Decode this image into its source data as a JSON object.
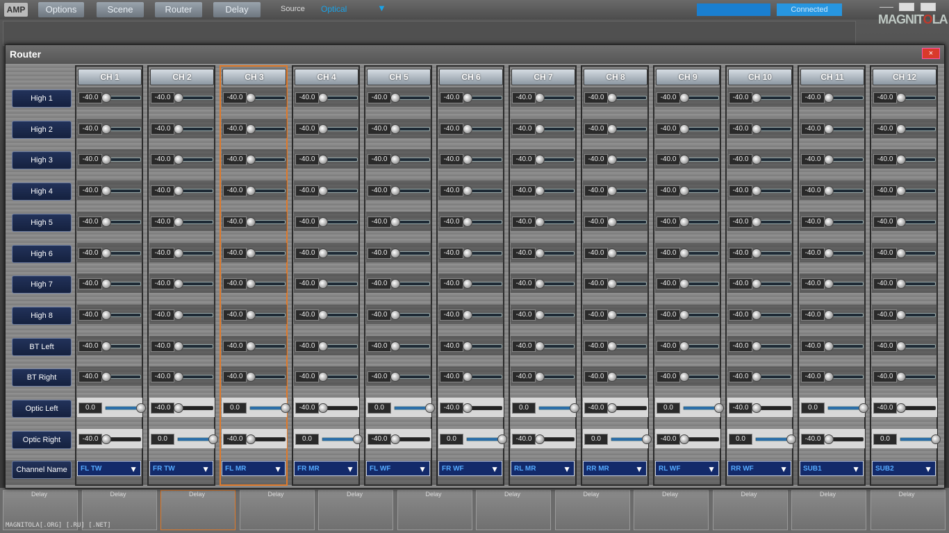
{
  "app": {
    "logo": "AMP",
    "menu": [
      "Options",
      "Scene",
      "Router",
      "Delay"
    ],
    "source_label": "Source",
    "source_value": "Optical",
    "status": "Connected",
    "brand": [
      "MAGNIT",
      "O",
      "LA"
    ],
    "footer": "MAGNITOLA[.ORG] [.RU] [.NET]",
    "delay_label": "Delay"
  },
  "router": {
    "title": "Router",
    "close": "×",
    "rows": [
      "High 1",
      "High 2",
      "High 3",
      "High 4",
      "High 5",
      "High 6",
      "High 7",
      "High 8",
      "BT Left",
      "BT Right",
      "Optic Left",
      "Optic Right"
    ],
    "channel_name_label": "Channel Name",
    "selected_channel": 2,
    "channels": [
      {
        "label": "CH 1",
        "name": "FL TW",
        "values": [
          "-40.0",
          "-40.0",
          "-40.0",
          "-40.0",
          "-40.0",
          "-40.0",
          "-40.0",
          "-40.0",
          "-40.0",
          "-40.0",
          "0.0",
          "-40.0"
        ]
      },
      {
        "label": "CH 2",
        "name": "FR TW",
        "values": [
          "-40.0",
          "-40.0",
          "-40.0",
          "-40.0",
          "-40.0",
          "-40.0",
          "-40.0",
          "-40.0",
          "-40.0",
          "-40.0",
          "-40.0",
          "0.0"
        ]
      },
      {
        "label": "CH 3",
        "name": "FL MR",
        "values": [
          "-40.0",
          "-40.0",
          "-40.0",
          "-40.0",
          "-40.0",
          "-40.0",
          "-40.0",
          "-40.0",
          "-40.0",
          "-40.0",
          "0.0",
          "-40.0"
        ]
      },
      {
        "label": "CH 4",
        "name": "FR MR",
        "values": [
          "-40.0",
          "-40.0",
          "-40.0",
          "-40.0",
          "-40.0",
          "-40.0",
          "-40.0",
          "-40.0",
          "-40.0",
          "-40.0",
          "-40.0",
          "0.0"
        ]
      },
      {
        "label": "CH 5",
        "name": "FL WF",
        "values": [
          "-40.0",
          "-40.0",
          "-40.0",
          "-40.0",
          "-40.0",
          "-40.0",
          "-40.0",
          "-40.0",
          "-40.0",
          "-40.0",
          "0.0",
          "-40.0"
        ]
      },
      {
        "label": "CH 6",
        "name": "FR WF",
        "values": [
          "-40.0",
          "-40.0",
          "-40.0",
          "-40.0",
          "-40.0",
          "-40.0",
          "-40.0",
          "-40.0",
          "-40.0",
          "-40.0",
          "-40.0",
          "0.0"
        ]
      },
      {
        "label": "CH 7",
        "name": "RL MR",
        "values": [
          "-40.0",
          "-40.0",
          "-40.0",
          "-40.0",
          "-40.0",
          "-40.0",
          "-40.0",
          "-40.0",
          "-40.0",
          "-40.0",
          "0.0",
          "-40.0"
        ]
      },
      {
        "label": "CH 8",
        "name": "RR MR",
        "values": [
          "-40.0",
          "-40.0",
          "-40.0",
          "-40.0",
          "-40.0",
          "-40.0",
          "-40.0",
          "-40.0",
          "-40.0",
          "-40.0",
          "-40.0",
          "0.0"
        ]
      },
      {
        "label": "CH 9",
        "name": "RL WF",
        "values": [
          "-40.0",
          "-40.0",
          "-40.0",
          "-40.0",
          "-40.0",
          "-40.0",
          "-40.0",
          "-40.0",
          "-40.0",
          "-40.0",
          "0.0",
          "-40.0"
        ]
      },
      {
        "label": "CH 10",
        "name": "RR WF",
        "values": [
          "-40.0",
          "-40.0",
          "-40.0",
          "-40.0",
          "-40.0",
          "-40.0",
          "-40.0",
          "-40.0",
          "-40.0",
          "-40.0",
          "-40.0",
          "0.0"
        ]
      },
      {
        "label": "CH 11",
        "name": "SUB1",
        "values": [
          "-40.0",
          "-40.0",
          "-40.0",
          "-40.0",
          "-40.0",
          "-40.0",
          "-40.0",
          "-40.0",
          "-40.0",
          "-40.0",
          "0.0",
          "-40.0"
        ]
      },
      {
        "label": "CH 12",
        "name": "SUB2",
        "values": [
          "-40.0",
          "-40.0",
          "-40.0",
          "-40.0",
          "-40.0",
          "-40.0",
          "-40.0",
          "-40.0",
          "-40.0",
          "-40.0",
          "-40.0",
          "0.0"
        ]
      }
    ],
    "slider_range_db": [
      -40,
      0
    ],
    "icons": {
      "dropdown": "triangle-down-icon",
      "close": "close-icon"
    }
  },
  "colors": {
    "accent": "#2b6ea8",
    "selected_border": "#e07a2a",
    "close_bg": "#d93a2b",
    "label_bg": "#15213f"
  }
}
